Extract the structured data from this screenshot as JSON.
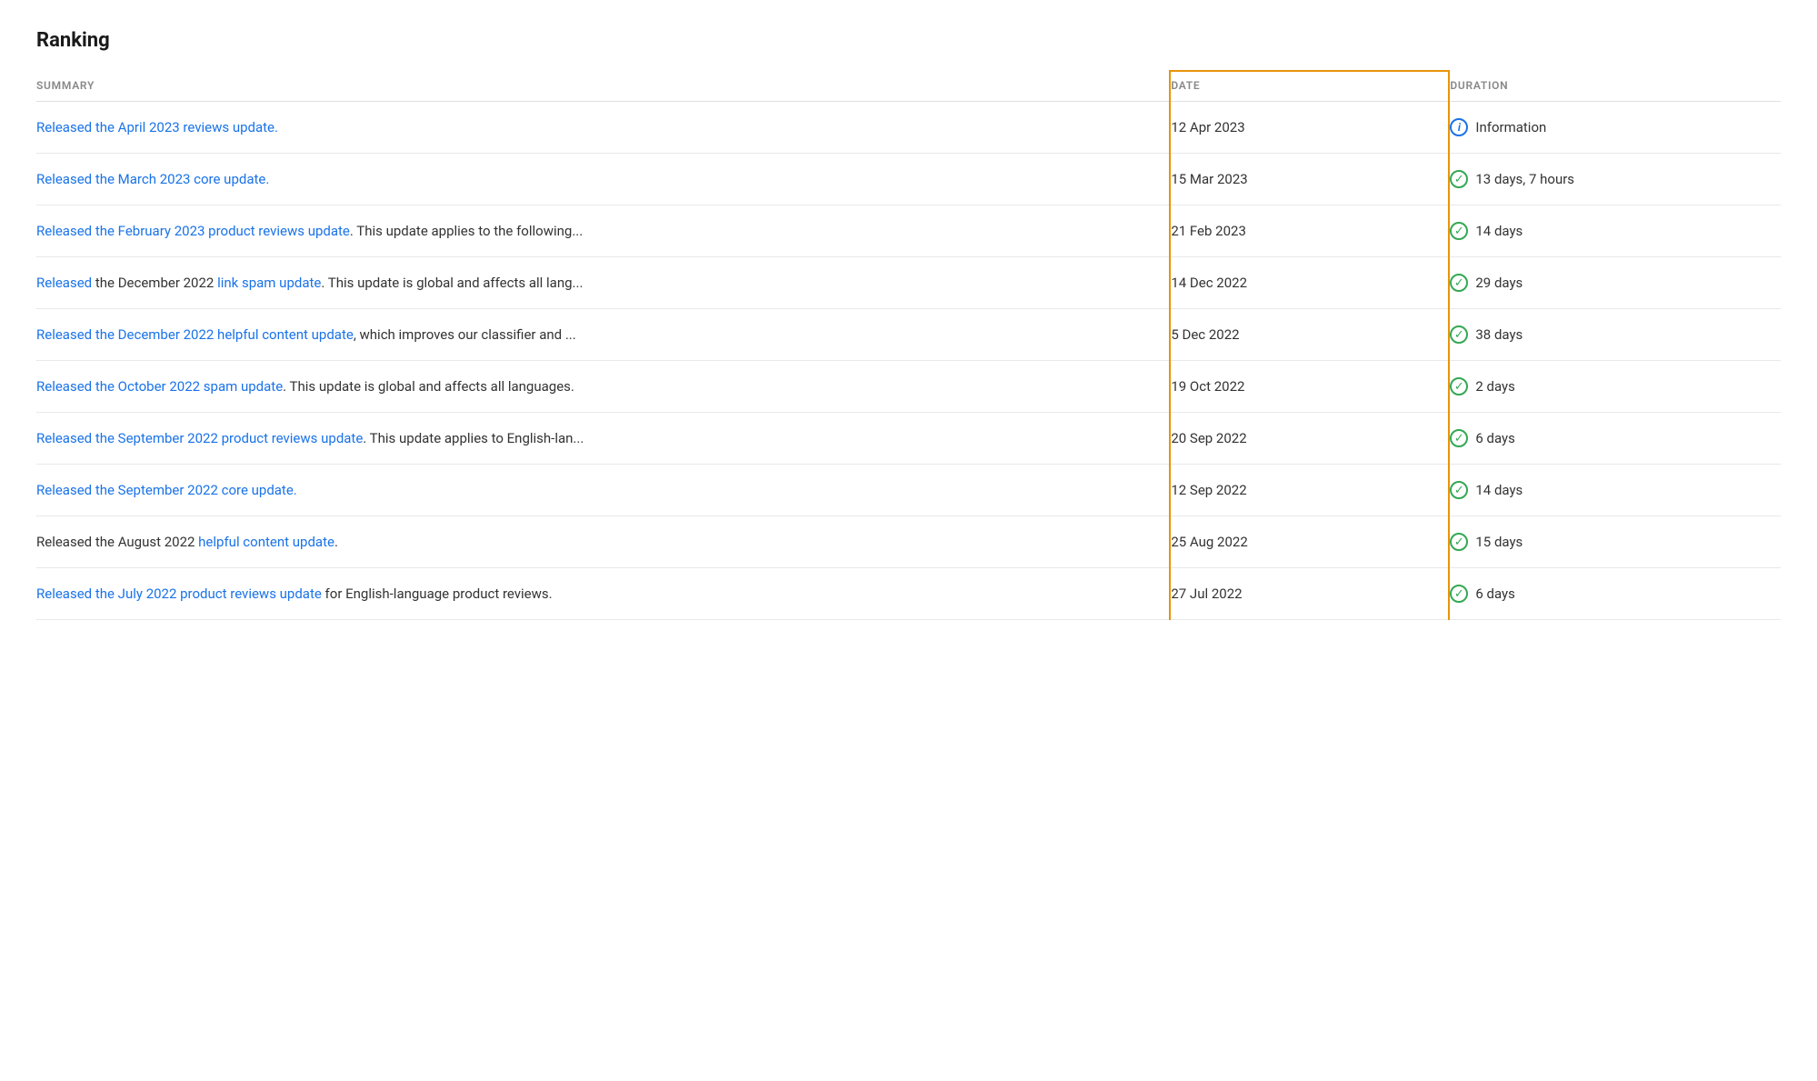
{
  "page": {
    "title": "Ranking"
  },
  "table": {
    "columns": {
      "summary": "SUMMARY",
      "date": "DATE",
      "duration": "DURATION"
    },
    "rows": [
      {
        "id": 1,
        "summary_parts": [
          {
            "text": "Released the April 2023 reviews update.",
            "link": true
          }
        ],
        "date": "12 Apr 2023",
        "duration_icon": "info",
        "duration_text": "Information"
      },
      {
        "id": 2,
        "summary_parts": [
          {
            "text": "Released the March 2023 core update.",
            "link": true
          }
        ],
        "date": "15 Mar 2023",
        "duration_icon": "check",
        "duration_text": "13 days, 7 hours"
      },
      {
        "id": 3,
        "summary_parts": [
          {
            "text": "Released the February 2023 product reviews update",
            "link": true
          },
          {
            "text": ". This update applies to the following...",
            "link": false
          }
        ],
        "date": "21 Feb 2023",
        "duration_icon": "check",
        "duration_text": "14 days"
      },
      {
        "id": 4,
        "summary_parts": [
          {
            "text": "Released",
            "link": true
          },
          {
            "text": " the December 2022 ",
            "link": false
          },
          {
            "text": "link spam update",
            "link": true
          },
          {
            "text": ". This update is global and affects all lang...",
            "link": false
          }
        ],
        "date": "14 Dec 2022",
        "duration_icon": "check",
        "duration_text": "29 days"
      },
      {
        "id": 5,
        "summary_parts": [
          {
            "text": "Released the December 2022 helpful content update",
            "link": true
          },
          {
            "text": ", which improves our classifier and ...",
            "link": false
          }
        ],
        "date": "5 Dec 2022",
        "duration_icon": "check",
        "duration_text": "38 days"
      },
      {
        "id": 6,
        "summary_parts": [
          {
            "text": "Released the October 2022 spam update",
            "link": true
          },
          {
            "text": ". This update is global and affects all languages.",
            "link": false
          }
        ],
        "date": "19 Oct 2022",
        "duration_icon": "check",
        "duration_text": "2 days"
      },
      {
        "id": 7,
        "summary_parts": [
          {
            "text": "Released the September 2022 product reviews update",
            "link": true
          },
          {
            "text": ". This update applies to English-lan...",
            "link": false
          }
        ],
        "date": "20 Sep 2022",
        "duration_icon": "check",
        "duration_text": "6 days"
      },
      {
        "id": 8,
        "summary_parts": [
          {
            "text": "Released the September 2022 core update.",
            "link": true
          }
        ],
        "date": "12 Sep 2022",
        "duration_icon": "check",
        "duration_text": "14 days"
      },
      {
        "id": 9,
        "summary_parts": [
          {
            "text": "Released",
            "link": false
          },
          {
            "text": " the August 2022 ",
            "link": false
          },
          {
            "text": "helpful content update",
            "link": true
          },
          {
            "text": ".",
            "link": false
          }
        ],
        "date": "25 Aug 2022",
        "duration_icon": "check",
        "duration_text": "15 days"
      },
      {
        "id": 10,
        "summary_parts": [
          {
            "text": "Released the July 2022 product reviews update",
            "link": true
          },
          {
            "text": " for English-language product reviews.",
            "link": false
          }
        ],
        "date": "27 Jul 2022",
        "duration_icon": "check",
        "duration_text": "6 days"
      }
    ]
  }
}
